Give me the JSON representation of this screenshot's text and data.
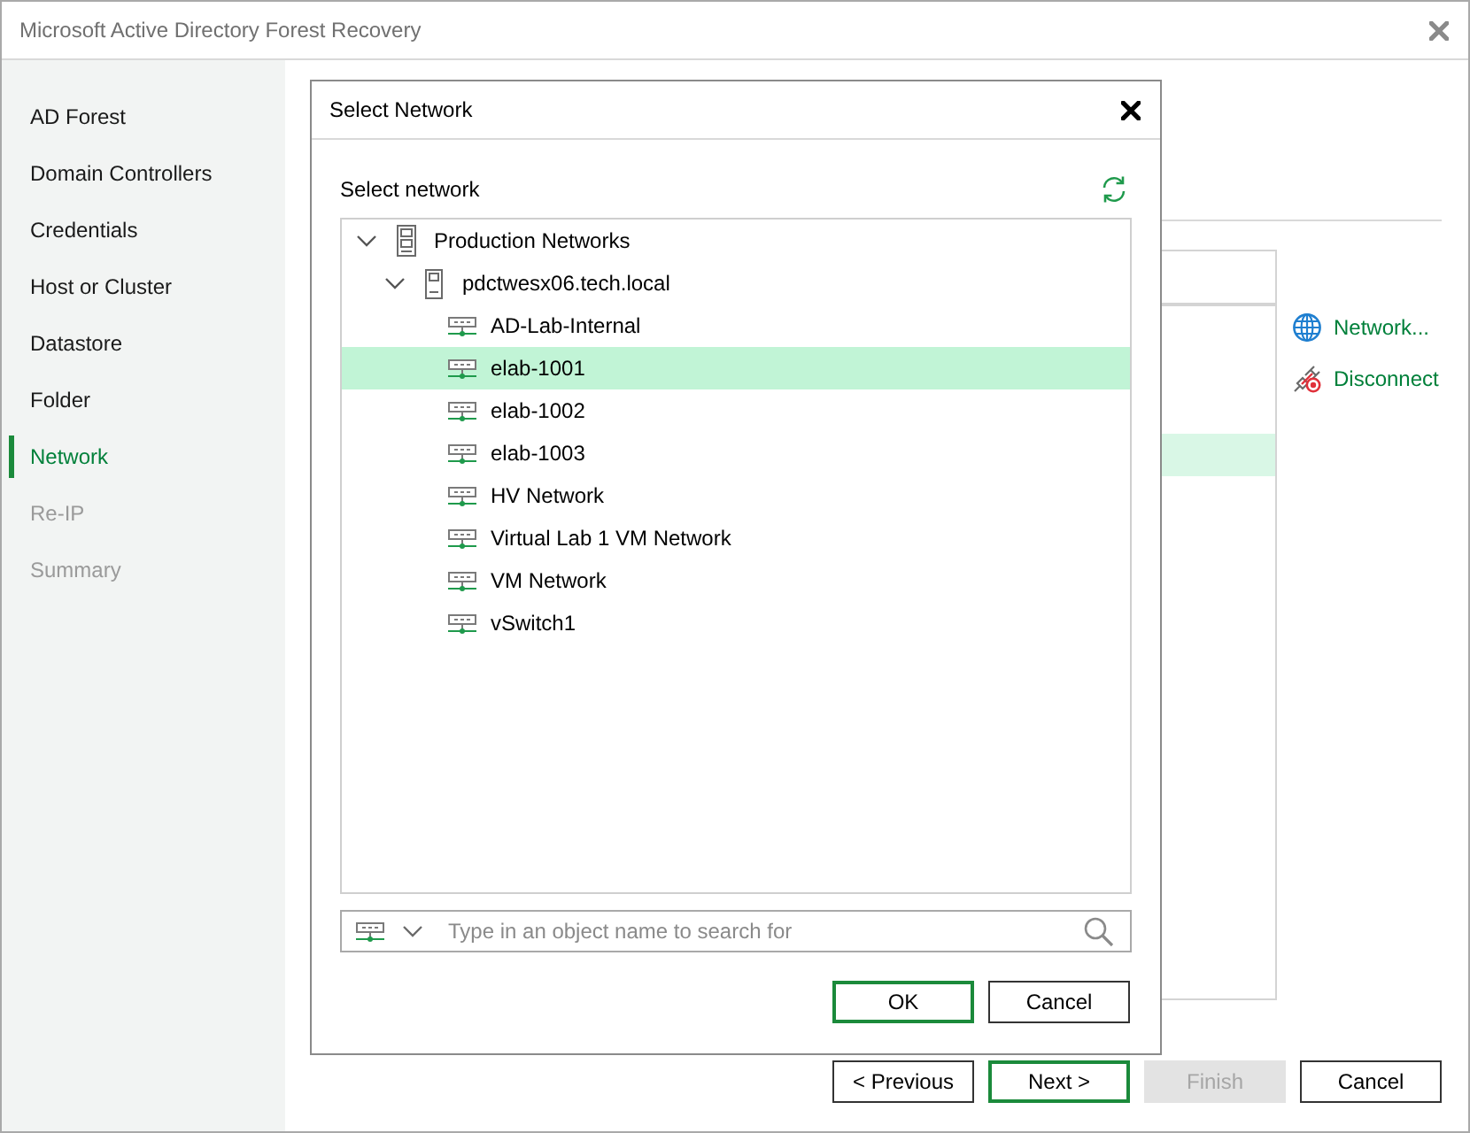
{
  "window": {
    "title": "Microsoft Active Directory Forest Recovery"
  },
  "sidebar": {
    "items": [
      {
        "label": "AD Forest",
        "selected": false,
        "disabled": false
      },
      {
        "label": "Domain Controllers",
        "selected": false,
        "disabled": false
      },
      {
        "label": "Credentials",
        "selected": false,
        "disabled": false
      },
      {
        "label": "Host or Cluster",
        "selected": false,
        "disabled": false
      },
      {
        "label": "Datastore",
        "selected": false,
        "disabled": false
      },
      {
        "label": "Folder",
        "selected": false,
        "disabled": false
      },
      {
        "label": "Network",
        "selected": true,
        "disabled": false
      },
      {
        "label": "Re-IP",
        "selected": false,
        "disabled": true
      },
      {
        "label": "Summary",
        "selected": false,
        "disabled": true
      }
    ]
  },
  "network_mapping": {
    "rows": [
      {
        "selected": false
      },
      {
        "selected": false
      },
      {
        "selected": false
      },
      {
        "selected": true
      }
    ],
    "actions": [
      {
        "kind": "network",
        "label": "Network..."
      },
      {
        "kind": "disconnect",
        "label": "Disconnect"
      }
    ]
  },
  "dialog": {
    "title": "Select Network",
    "label": "Select network",
    "tree": [
      {
        "label": "Production Networks",
        "kind": "folder",
        "expanded": true,
        "selected": false,
        "children": [
          {
            "label": "pdctwesx06.tech.local",
            "kind": "host",
            "expanded": true,
            "selected": false,
            "children": [
              {
                "label": "AD-Lab-Internal",
                "kind": "network",
                "selected": false
              },
              {
                "label": "elab-1001",
                "kind": "network",
                "selected": true
              },
              {
                "label": "elab-1002",
                "kind": "network",
                "selected": false
              },
              {
                "label": "elab-1003",
                "kind": "network",
                "selected": false
              },
              {
                "label": "HV Network",
                "kind": "network",
                "selected": false
              },
              {
                "label": "Virtual Lab 1 VM Network",
                "kind": "network",
                "selected": false
              },
              {
                "label": "VM Network",
                "kind": "network",
                "selected": false
              },
              {
                "label": "vSwitch1",
                "kind": "network",
                "selected": false
              }
            ]
          }
        ]
      }
    ],
    "search": {
      "placeholder": "Type in an object name to search for"
    },
    "buttons": [
      {
        "label": "OK",
        "default": true
      },
      {
        "label": "Cancel",
        "default": false
      }
    ]
  },
  "wizard_buttons": [
    {
      "label": "< Previous",
      "default": false,
      "disabled": false
    },
    {
      "label": "Next >",
      "default": true,
      "disabled": false
    },
    {
      "label": "Finish",
      "default": false,
      "disabled": true
    },
    {
      "label": "Cancel",
      "default": false,
      "disabled": false
    }
  ]
}
